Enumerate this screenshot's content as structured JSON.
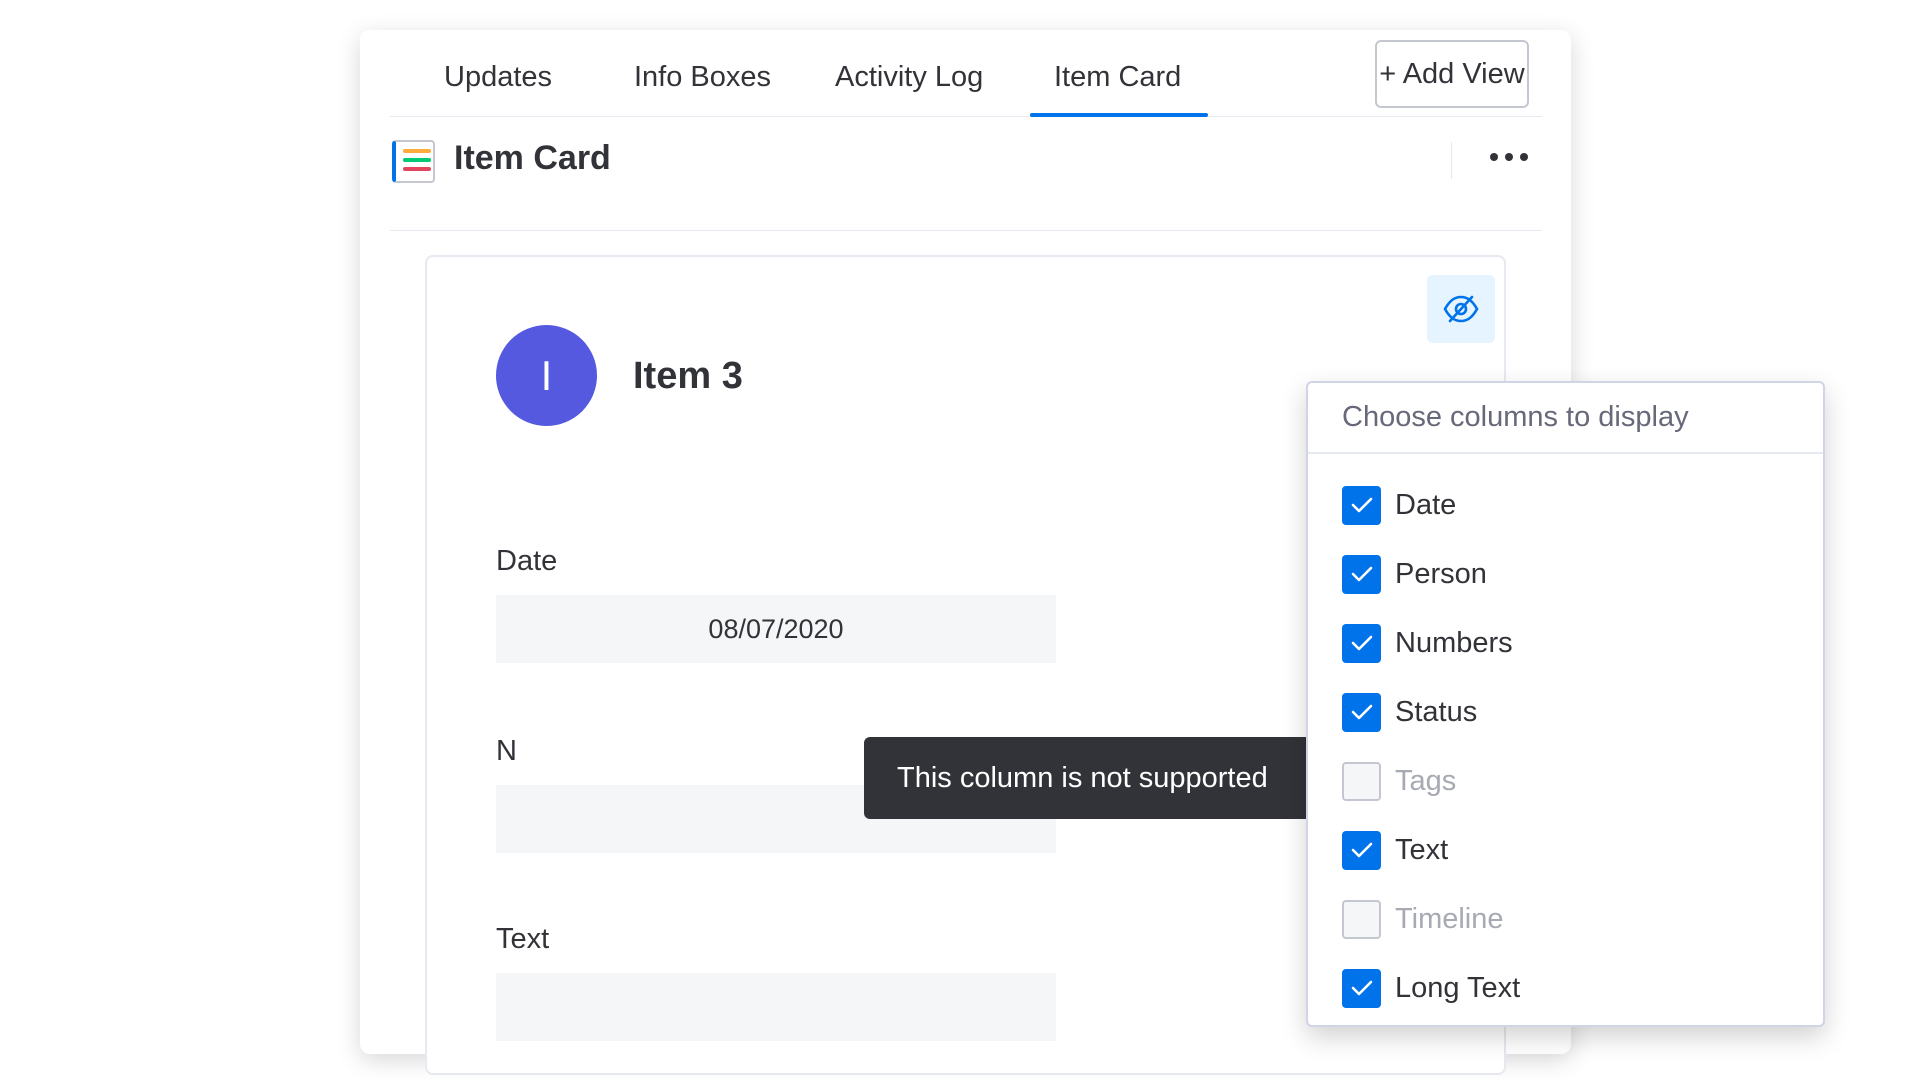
{
  "tabs": [
    {
      "label": "Updates"
    },
    {
      "label": "Info Boxes"
    },
    {
      "label": "Activity Log"
    },
    {
      "label": "Item Card",
      "active": true
    }
  ],
  "add_view_label": "+ Add View",
  "view": {
    "title": "Item Card"
  },
  "item": {
    "avatar_letter": "I",
    "name": "Item 3"
  },
  "fields": {
    "date_label": "Date",
    "date_value": "08/07/2020",
    "numbers_label_partial": "N",
    "text_label": "Text"
  },
  "tooltip_text": "This column is not supported",
  "dropdown": {
    "title": "Choose columns to display",
    "columns": [
      {
        "label": "Date",
        "checked": true,
        "enabled": true
      },
      {
        "label": "Person",
        "checked": true,
        "enabled": true
      },
      {
        "label": "Numbers",
        "checked": true,
        "enabled": true
      },
      {
        "label": "Status",
        "checked": true,
        "enabled": true
      },
      {
        "label": "Tags",
        "checked": false,
        "enabled": false
      },
      {
        "label": "Text",
        "checked": true,
        "enabled": true
      },
      {
        "label": "Timeline",
        "checked": false,
        "enabled": false
      },
      {
        "label": "Long Text",
        "checked": true,
        "enabled": true
      }
    ]
  },
  "colors": {
    "accent": "#0073ea",
    "avatar": "#5559df",
    "tooltip_bg": "#323338",
    "eye_button_bg": "#e5f4ff",
    "title_icon_bars": [
      "#fdab3d",
      "#00c875",
      "#e2445c"
    ]
  }
}
